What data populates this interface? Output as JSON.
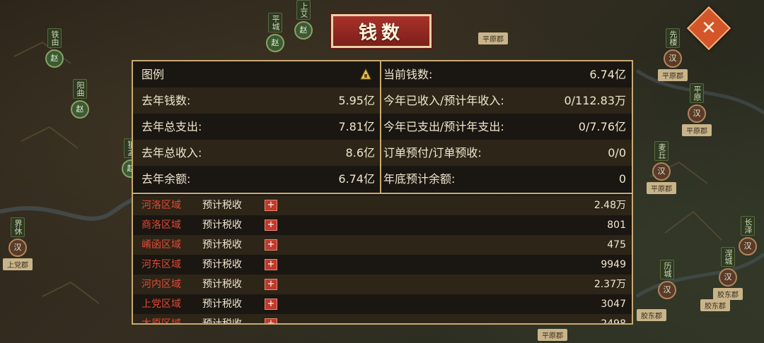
{
  "title": "钱数",
  "summary": {
    "left": [
      {
        "label": "图例",
        "value": ""
      },
      {
        "label": "去年钱数:",
        "value": "5.95亿"
      },
      {
        "label": "去年总支出:",
        "value": "7.81亿"
      },
      {
        "label": "去年总收入:",
        "value": "8.6亿"
      },
      {
        "label": "去年余额:",
        "value": "6.74亿"
      }
    ],
    "right": [
      {
        "label": "当前钱数:",
        "value": "6.74亿"
      },
      {
        "label": "今年已收入/预计年收入:",
        "value": "0/112.83万"
      },
      {
        "label": "今年已支出/预计年支出:",
        "value": "0/7.76亿"
      },
      {
        "label": "订单预付/订单预收:",
        "value": "0/0"
      },
      {
        "label": "年底预计余额:",
        "value": "0"
      }
    ]
  },
  "regions": [
    {
      "name": "河洛区域",
      "type": "预计税收",
      "plus": "+",
      "value": "2.48万"
    },
    {
      "name": "商洛区域",
      "type": "预计税收",
      "plus": "+",
      "value": "801"
    },
    {
      "name": "崤函区域",
      "type": "预计税收",
      "plus": "+",
      "value": "475"
    },
    {
      "name": "河东区域",
      "type": "预计税收",
      "plus": "+",
      "value": "9949"
    },
    {
      "name": "河内区域",
      "type": "预计税收",
      "plus": "+",
      "value": "2.37万"
    },
    {
      "name": "上党区域",
      "type": "预计税收",
      "plus": "+",
      "value": "3047"
    },
    {
      "name": "太原区域",
      "type": "预计税收",
      "plus": "+",
      "value": "2498"
    }
  ],
  "map": {
    "cities": [
      {
        "name": "铁由",
        "seal": "赵"
      },
      {
        "name": "阳曲",
        "seal": "赵"
      },
      {
        "name": "狼孟",
        "seal": "赵"
      },
      {
        "name": "平城",
        "seal": "赵"
      },
      {
        "name": "上艾",
        "seal": "赵"
      },
      {
        "name": "界休",
        "seal": "汉"
      },
      {
        "name": "先楼",
        "seal": "汉"
      },
      {
        "name": "平原",
        "seal": "汉"
      },
      {
        "name": "麦丘",
        "seal": "汉"
      },
      {
        "name": "长泽",
        "seal": "汉"
      },
      {
        "name": "涅城",
        "seal": "汉"
      },
      {
        "name": "历城",
        "seal": "汉"
      }
    ],
    "jun_labels": [
      "平原郡",
      "平原郡",
      "平原郡",
      "平原郡",
      "平原郡",
      "上党郡",
      "胶东郡",
      "胶东郡",
      "胶东郡"
    ]
  },
  "close_icon": "close-icon",
  "colors": {
    "accent": "#c9aa72",
    "region_red": "#e04a36",
    "title_red": "#a8322a"
  }
}
